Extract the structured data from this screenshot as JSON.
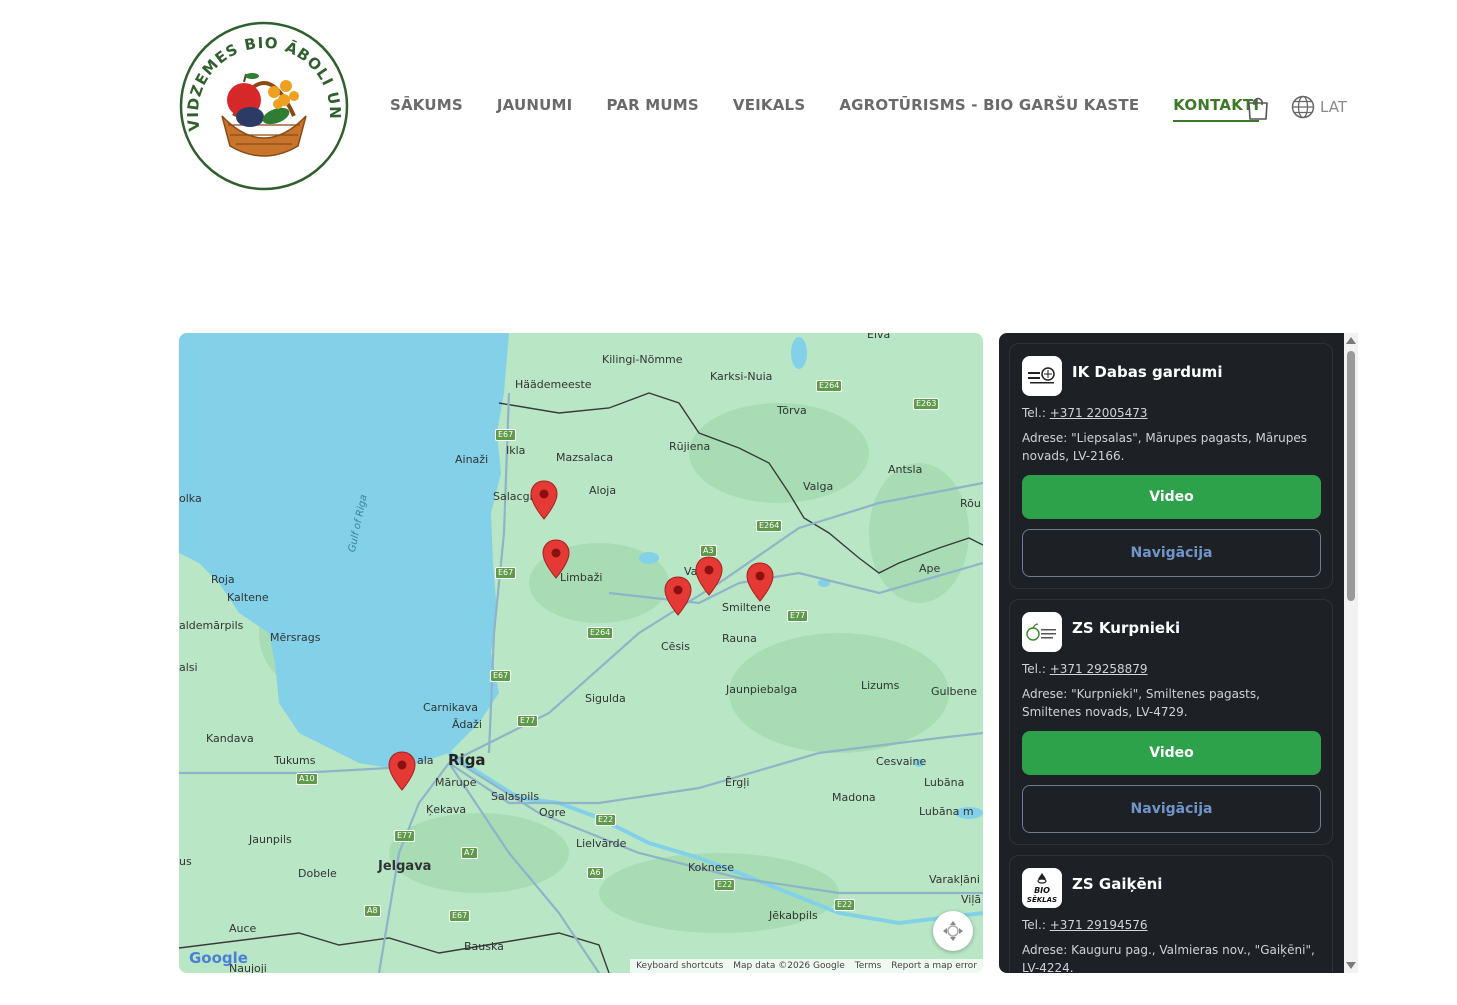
{
  "logo": {
    "text": "VIDZEMES BIO ĀBOLI UN OGAS"
  },
  "nav": {
    "items": [
      {
        "label": "SĀKUMS",
        "active": false
      },
      {
        "label": "JAUNUMI",
        "active": false
      },
      {
        "label": "PAR MUMS",
        "active": false
      },
      {
        "label": "VEIKALS",
        "active": false
      },
      {
        "label": "AGROTŪRISMS - BIO GARŠU KASTE",
        "active": false
      },
      {
        "label": "KONTAKTI",
        "active": true
      }
    ],
    "cart_icon": "shopping-bag-icon",
    "language": "LAT",
    "language_icon": "globe-icon",
    "active_color": "#3c7a27"
  },
  "map": {
    "places": {
      "kilingi": "Kilingi-Nõmme",
      "haademeeste": "Häädemeeste",
      "karksi": "Karksi-Nuia",
      "torva": "Tõrva",
      "elva": "Elva",
      "ainazi": "Ainaži",
      "ikla": "Ikla",
      "mazsalaca": "Mazsalaca",
      "rujiena": "Rūjiena",
      "antsla": "Antsla",
      "salacgriva": "Salacgr",
      "aloja": "Aloja",
      "valga": "Valga",
      "rou": "Rõu",
      "olka": "olka",
      "gulf": "Gulf of Riga",
      "limbazi": "Limbaži",
      "valmiera": "Va   iera",
      "ape": "Ape",
      "roja": "Roja",
      "kaltene": "Kaltene",
      "smiltene": "Smiltene",
      "valdemarpils": "aldemārpils",
      "mersrags": "Mērsrags",
      "cesis": "Cēsis",
      "rauna": "Rauna",
      "talsi": "alsi",
      "lizums": "Lizums",
      "jaunpiebalga": "Jaunpiebalga",
      "gulbene": "Gulbene",
      "sigulda": "Sigulda",
      "carnikava": "Carnikava",
      "adazi": "Ādaži",
      "kandava": "Kandava",
      "tukums": "Tukums",
      "jurmala": "ala",
      "riga": "Riga",
      "cesvaine": "Cesvaine",
      "marupe": "Mārupe",
      "ergli": "Ērgļi",
      "lubana": "Lubāna",
      "salaspils": "Salaspils",
      "madona": "Madona",
      "kekava": "Ķekava",
      "ogre": "Ogre",
      "lubana_lake": "Lubāna m",
      "jaunpils": "Jaunpils",
      "lielvarde": "Lielvārde",
      "us": "us",
      "jelgava": "Jelgava",
      "koknese": "Koknese",
      "dobele": "Dobele",
      "varaklani": "Varakļāni",
      "vilani": "Viļā",
      "auce": "Auce",
      "jekabpils": "Jēkabpils",
      "bauska": "Bauska",
      "naujoji": "Naujoji"
    },
    "roads": {
      "e67a": "E67",
      "e264a": "E264",
      "e263": "E263",
      "e264b": "E264",
      "a3": "A3",
      "e67b": "E67",
      "e264c": "E264",
      "e77a": "E77",
      "e67c": "E67",
      "e77b": "E77",
      "a10": "A10",
      "e22a": "E22",
      "e77c": "E77",
      "a7": "A7",
      "a6": "A6",
      "e22b": "E22",
      "a8": "A8",
      "e67d": "E67",
      "e22c": "E22"
    },
    "footer": {
      "shortcuts": "Keyboard shortcuts",
      "data": "Map data ©2026 Google",
      "terms": "Terms",
      "report": "Report a map error"
    },
    "google_logo": "Google",
    "marker_color": "#e53935"
  },
  "contacts": [
    {
      "name": "IK Dabas gardumi",
      "tel_label": "Tel.:",
      "tel": "+371 22005473",
      "address": "Adrese: \"Liepsalas\", Mārupes pagasts, Mārupes novads, LV-2166.",
      "video": "Video",
      "navigation": "Navigācija"
    },
    {
      "name": "ZS Kurpnieki",
      "tel_label": "Tel.:",
      "tel": "+371 29258879",
      "address": "Adrese: \"Kurpnieki\", Smiltenes pagasts, Smiltenes novads, LV-4729.",
      "video": "Video",
      "navigation": "Navigācija"
    },
    {
      "name": "ZS Gaiķēni",
      "tel_label": "Tel.:",
      "tel": "+371 29194576",
      "address": "Adrese: Kauguru pag., Valmieras nov., \"Gaiķēni\", LV-4224.",
      "logo_text": "BIO SĒKLAS"
    }
  ],
  "colors": {
    "panel_bg": "#1d2126",
    "video_button": "#2ea24a",
    "nav_button_text": "#6f95c9"
  }
}
